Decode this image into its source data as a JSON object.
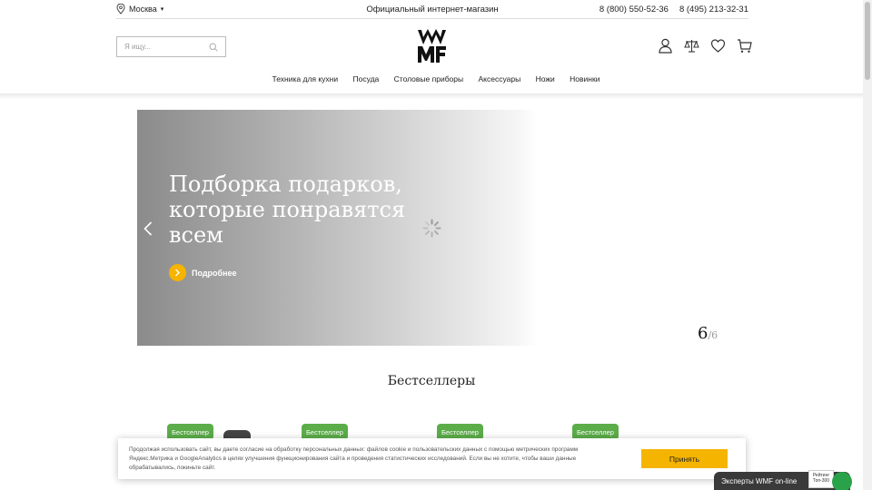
{
  "topbar": {
    "city": "Москва",
    "city_arrow": "▾",
    "tagline": "Официальный интернет-магазин",
    "phones": [
      "8 (800) 550-52-36",
      "8 (495) 213-32-31"
    ]
  },
  "search": {
    "placeholder": "Я ищу..."
  },
  "header_icons": [
    "user-icon",
    "compare-icon",
    "heart-icon",
    "cart-icon"
  ],
  "nav": [
    "Техника для кухни",
    "Посуда",
    "Столовые приборы",
    "Аксессуары",
    "Ножи",
    "Новинки"
  ],
  "banner": {
    "title": "Подборка подарков, которые понравятся всем",
    "more_label": "Подробнее",
    "current_slide": "6",
    "total_slides": "/6"
  },
  "bestsellers": {
    "title": "Бестселлеры",
    "badges": [
      "Бестселлер",
      "Бестселлер",
      "Бестселлер",
      "Бестселлер"
    ]
  },
  "cookie": {
    "text": "Продолжая использовать сайт, вы даете согласие на обработку персональных данных: файлов cookie и пользовательских данных с помощью метрических программ Яндекс.Метрика и GoogleAnalytics в целях улучшения функционирования сайта и проведения статистических исследований. Если вы не хотите, чтобы ваши данные обрабатывались, покиньте сайт.",
    "accept_label": "Принять"
  },
  "chat": {
    "label": "Эксперты WMF on-line",
    "rating_label": "Рейтинг",
    "rating_sub": "Топ-300"
  },
  "colors": {
    "accent": "#f5b400",
    "badge": "#5cad4a"
  }
}
